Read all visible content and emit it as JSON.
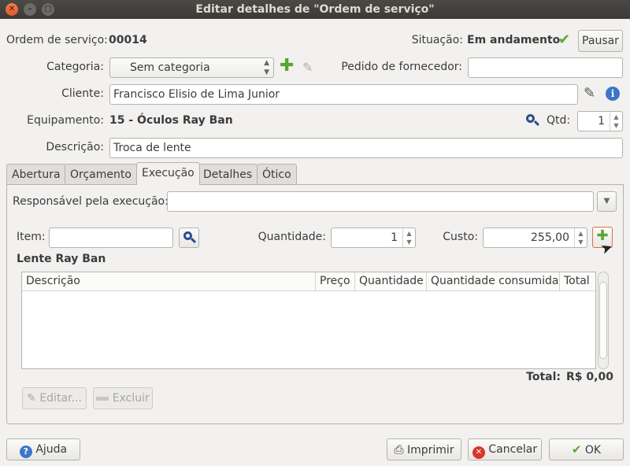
{
  "window": {
    "title": "Editar detalhes de \"Ordem de serviço\"",
    "close": "✕",
    "minimize": "–",
    "maximize": "□"
  },
  "header": {
    "order_label": "Ordem de serviço:",
    "order_value": "00014",
    "status_label": "Situação:",
    "status_value": "Em andamento",
    "pause_label": "Pausar",
    "category_label": "Categoria:",
    "category_value": "Sem categoria",
    "supplier_label": "Pedido de fornecedor:",
    "supplier_value": "",
    "client_label": "Cliente:",
    "client_value": "Francisco Elisio de Lima Junior",
    "equipment_label": "Equipamento:",
    "equipment_value": "15 - Óculos Ray Ban",
    "qty_label": "Qtd:",
    "qty_value": "1",
    "description_label": "Descrição:",
    "description_value": "Troca de lente"
  },
  "tabs": [
    {
      "label": "Abertura"
    },
    {
      "label": "Orçamento"
    },
    {
      "label": "Execução"
    },
    {
      "label": "Detalhes"
    },
    {
      "label": "Ótico"
    }
  ],
  "execution": {
    "responsible_label": "Responsável pela execução:",
    "responsible_value": "",
    "item_label": "Item:",
    "item_value": "",
    "quantity_label": "Quantidade:",
    "quantity_value": "1",
    "cost_label": "Custo:",
    "cost_value": "255,00",
    "selected_item": "Lente Ray Ban",
    "columns": [
      "Descrição",
      "Preço",
      "Quantidade",
      "Quantidade consumida",
      "Total"
    ],
    "rows": [],
    "total_label": "Total:",
    "total_value": "R$ 0,00",
    "edit_label": "Editar...",
    "delete_label": "Excluir"
  },
  "footer": {
    "help_label": "Ajuda",
    "print_label": "Imprimir",
    "cancel_label": "Cancelar",
    "ok_label": "OK"
  },
  "colors": {
    "accent_green": "#5aa532",
    "title_bar": "#3b3a37",
    "close_orange": "#e05a2b",
    "focus_border": "#e0713c"
  },
  "icons": [
    "close-icon",
    "minimize-icon",
    "maximize-icon",
    "check-icon",
    "add-icon",
    "edit-icon",
    "info-icon",
    "search-icon",
    "dropdown-arrow-icon",
    "help-icon",
    "print-icon",
    "cancel-icon",
    "delete-icon",
    "cursor-icon"
  ]
}
